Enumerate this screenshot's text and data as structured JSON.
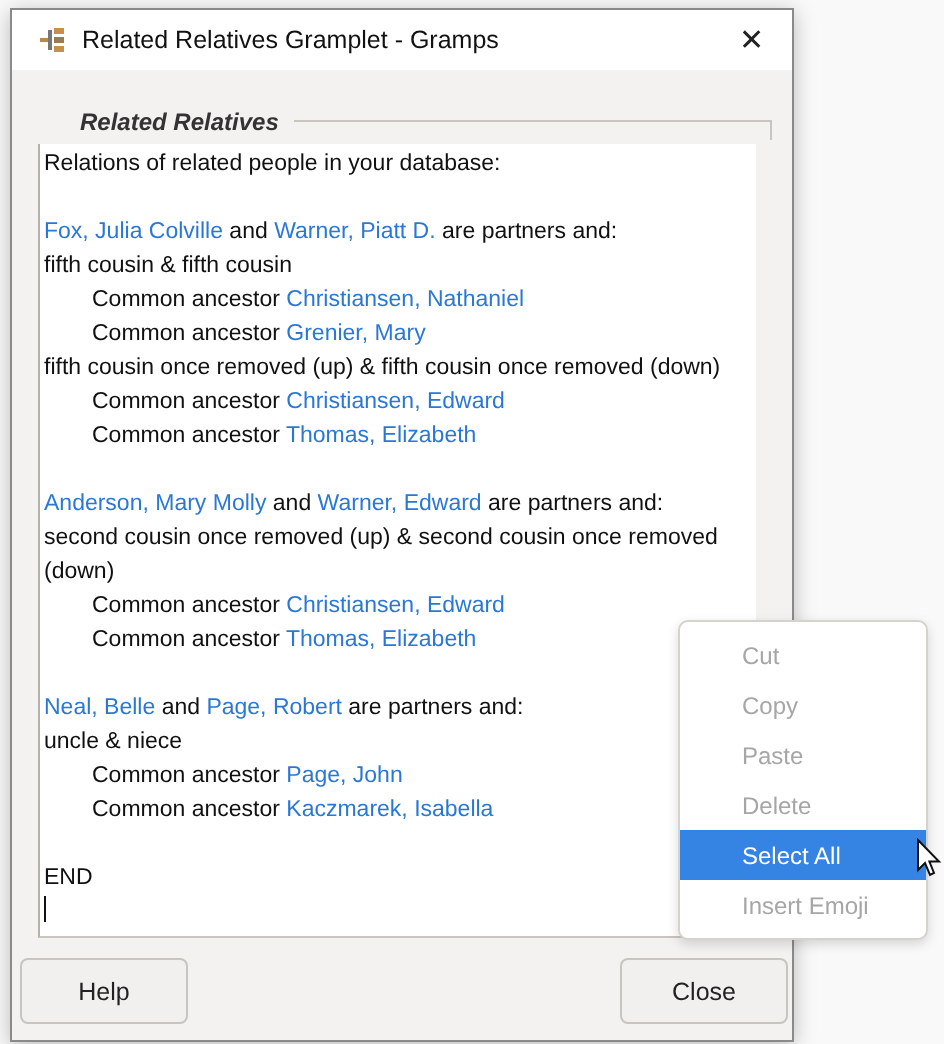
{
  "window": {
    "title": "Related Relatives Gramplet - Gramps",
    "close_glyph": "✕"
  },
  "frame": {
    "label": "Related Relatives"
  },
  "lines": [
    {
      "kind": "text",
      "parts": [
        {
          "text": "Relations of related people in your database:",
          "link": false
        }
      ]
    },
    {
      "kind": "blank"
    },
    {
      "kind": "text",
      "parts": [
        {
          "text": "Fox, Julia Colville",
          "link": true
        },
        {
          "text": " and ",
          "link": false
        },
        {
          "text": "Warner, Piatt D.",
          "link": true
        },
        {
          "text": " are partners and:",
          "link": false
        }
      ]
    },
    {
      "kind": "text",
      "parts": [
        {
          "text": "fifth cousin & fifth cousin",
          "link": false
        }
      ]
    },
    {
      "kind": "ancestor",
      "parts": [
        {
          "text": "Common ancestor ",
          "link": false
        },
        {
          "text": "Christiansen, Nathaniel",
          "link": true
        }
      ]
    },
    {
      "kind": "ancestor",
      "parts": [
        {
          "text": "Common ancestor ",
          "link": false
        },
        {
          "text": "Grenier, Mary",
          "link": true
        }
      ]
    },
    {
      "kind": "text",
      "parts": [
        {
          "text": "fifth cousin once removed (up) & fifth cousin once removed (down)",
          "link": false
        }
      ]
    },
    {
      "kind": "ancestor",
      "parts": [
        {
          "text": "Common ancestor ",
          "link": false
        },
        {
          "text": "Christiansen, Edward",
          "link": true
        }
      ]
    },
    {
      "kind": "ancestor",
      "parts": [
        {
          "text": "Common ancestor ",
          "link": false
        },
        {
          "text": "Thomas, Elizabeth",
          "link": true
        }
      ]
    },
    {
      "kind": "blank"
    },
    {
      "kind": "text",
      "parts": [
        {
          "text": "Anderson, Mary Molly",
          "link": true
        },
        {
          "text": " and ",
          "link": false
        },
        {
          "text": "Warner, Edward",
          "link": true
        },
        {
          "text": " are partners and:",
          "link": false
        }
      ]
    },
    {
      "kind": "text",
      "parts": [
        {
          "text": "second cousin once removed (up) & second cousin once removed (down)",
          "link": false
        }
      ]
    },
    {
      "kind": "ancestor",
      "parts": [
        {
          "text": "Common ancestor ",
          "link": false
        },
        {
          "text": "Christiansen, Edward",
          "link": true
        }
      ]
    },
    {
      "kind": "ancestor",
      "parts": [
        {
          "text": "Common ancestor ",
          "link": false
        },
        {
          "text": "Thomas, Elizabeth",
          "link": true
        }
      ]
    },
    {
      "kind": "blank"
    },
    {
      "kind": "text",
      "parts": [
        {
          "text": "Neal, Belle",
          "link": true
        },
        {
          "text": " and ",
          "link": false
        },
        {
          "text": "Page, Robert",
          "link": true
        },
        {
          "text": " are partners and:",
          "link": false
        }
      ]
    },
    {
      "kind": "text",
      "parts": [
        {
          "text": "uncle & niece",
          "link": false
        }
      ]
    },
    {
      "kind": "ancestor",
      "parts": [
        {
          "text": "Common ancestor ",
          "link": false
        },
        {
          "text": "Page, John",
          "link": true
        }
      ]
    },
    {
      "kind": "ancestor",
      "parts": [
        {
          "text": "Common ancestor ",
          "link": false
        },
        {
          "text": "Kaczmarek, Isabella",
          "link": true
        }
      ]
    },
    {
      "kind": "blank"
    },
    {
      "kind": "text",
      "parts": [
        {
          "text": "END",
          "link": false
        }
      ]
    }
  ],
  "buttons": [
    {
      "label": "Help"
    },
    {
      "label": "Close"
    }
  ],
  "context_menu": [
    {
      "label": "Cut",
      "disabled": true,
      "selected": false
    },
    {
      "label": "Copy",
      "disabled": true,
      "selected": false
    },
    {
      "label": "Paste",
      "disabled": true,
      "selected": false
    },
    {
      "label": "Delete",
      "disabled": true,
      "selected": false
    },
    {
      "label": "Select All",
      "disabled": false,
      "selected": true
    },
    {
      "label": "Insert Emoji",
      "disabled": true,
      "selected": false
    }
  ]
}
